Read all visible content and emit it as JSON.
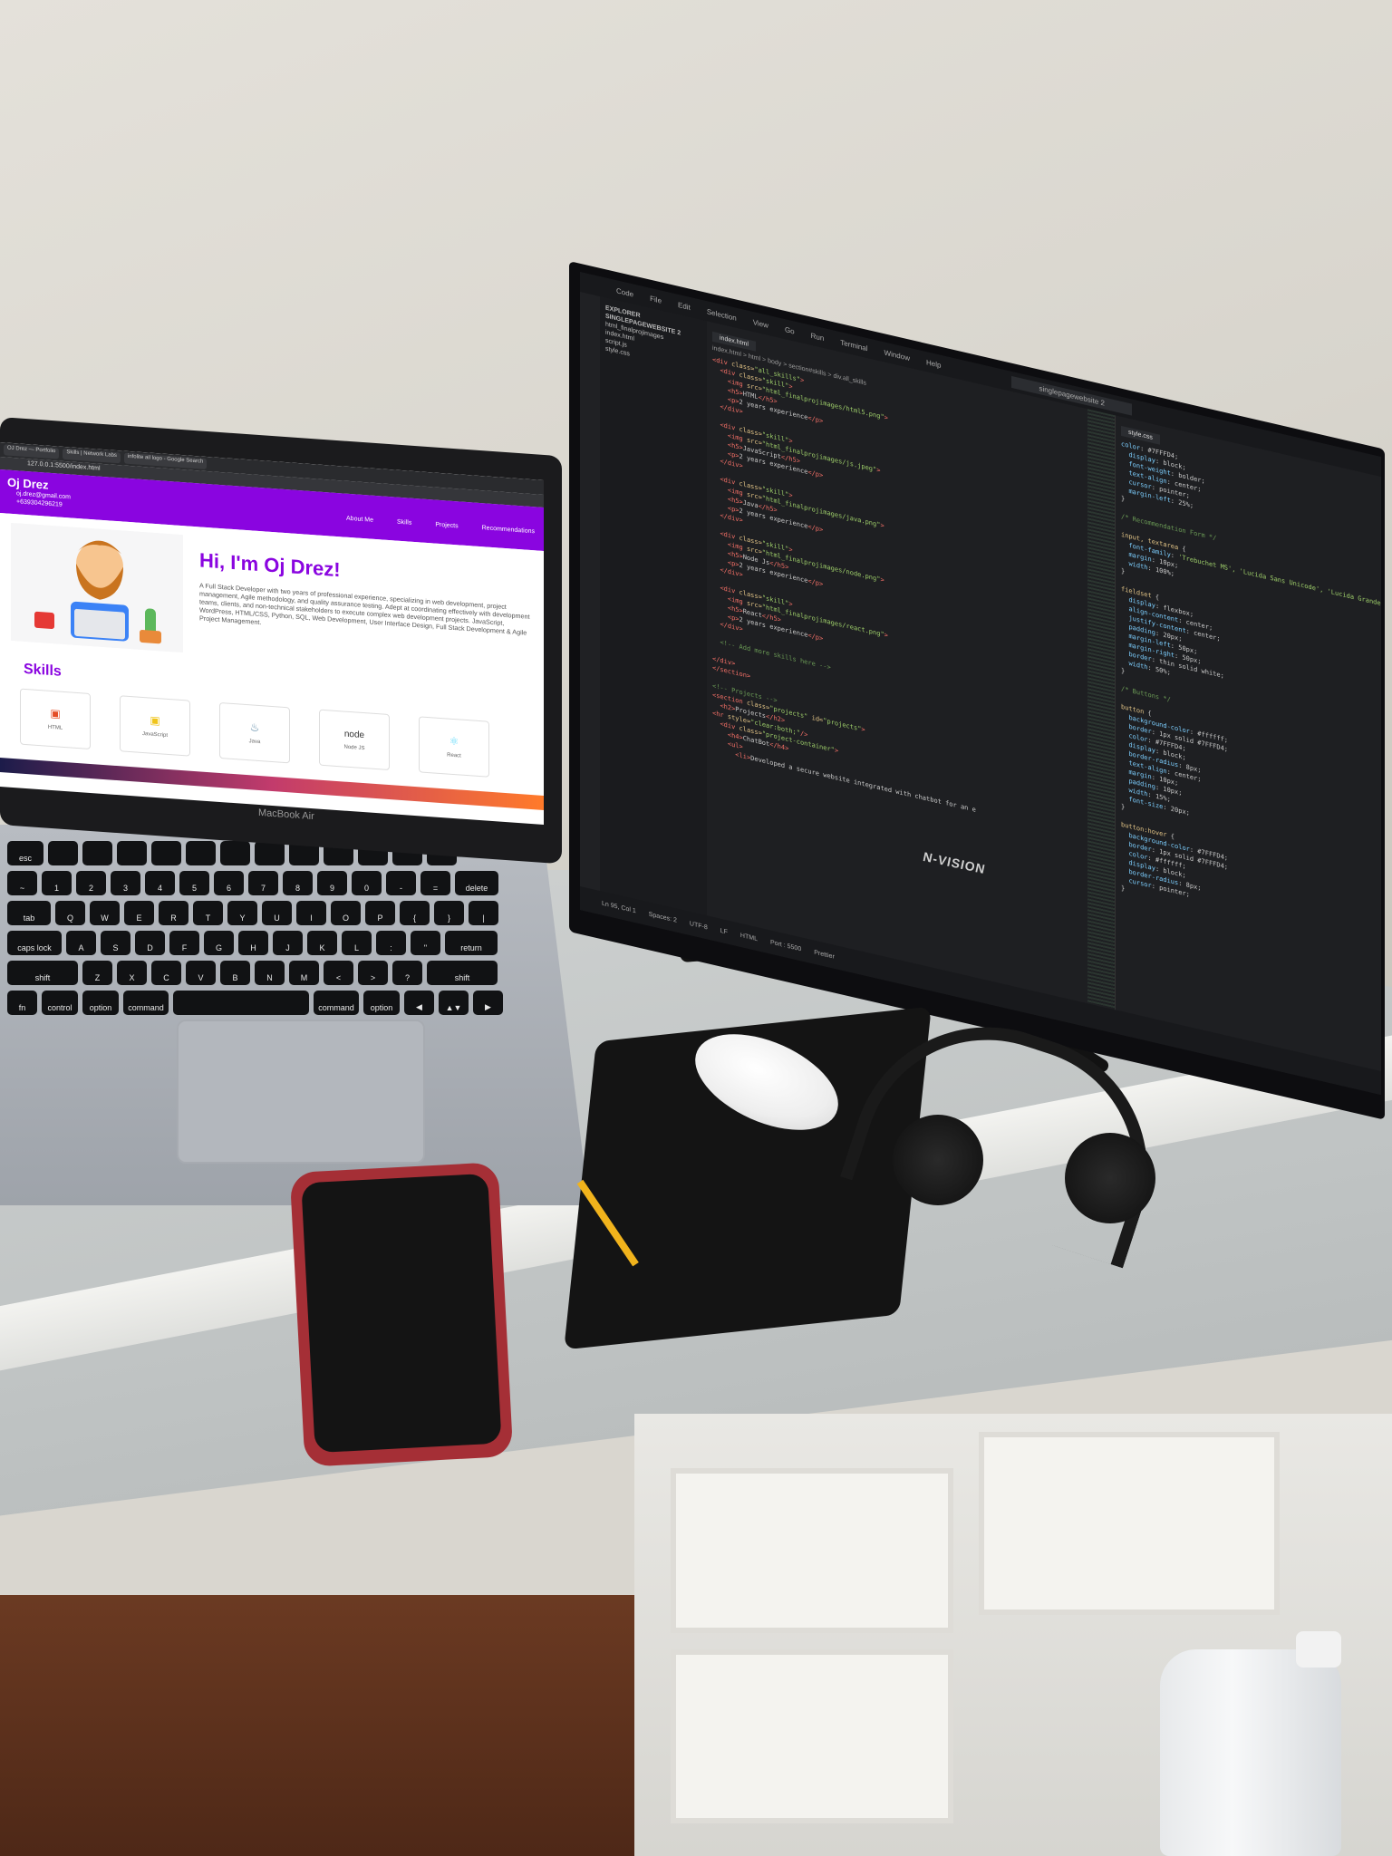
{
  "laptop": {
    "brand": "MacBook Air",
    "browser": {
      "tabs": [
        "OJ Drez — Portfolio",
        "Skills | Network Labs",
        "infolite ail logo - Google Search"
      ],
      "url": "127.0.0.1:5500/index.html"
    },
    "site": {
      "name": "Oj Drez",
      "email": "oj.drez@gmail.com",
      "phone": "+639304296219",
      "nav": [
        "About Me",
        "Skills",
        "Projects",
        "Recommendations"
      ],
      "hero_title": "Hi, I'm Oj Drez!",
      "hero_bio": "A Full Stack Developer with two years of professional experience, specializing in web development, project management, Agile methodology, and quality assurance testing. Adept at coordinating effectively with development teams, clients, and non-technical stakeholders to execute complex web development projects. JavaScript, WordPress, HTML/CSS, Python, SQL, Web Development, User Interface Design, Full Stack Development & Agile Project Management.",
      "skills_title": "Skills",
      "skills": [
        "HTML",
        "JavaScript",
        "Java",
        "Node JS",
        "React"
      ]
    },
    "keyboard": {
      "row1": [
        "esc",
        "",
        "",
        "",
        "",
        "",
        "",
        "",
        "",
        "",
        "",
        "",
        "",
        ""
      ],
      "row2": [
        "~",
        "1",
        "2",
        "3",
        "4",
        "5",
        "6",
        "7",
        "8",
        "9",
        "0",
        "-",
        "=",
        "delete"
      ],
      "row3": [
        "tab",
        "Q",
        "W",
        "E",
        "R",
        "T",
        "Y",
        "U",
        "I",
        "O",
        "P",
        "{",
        "}",
        "|"
      ],
      "row4": [
        "caps lock",
        "A",
        "S",
        "D",
        "F",
        "G",
        "H",
        "J",
        "K",
        "L",
        ":",
        "\"",
        "return"
      ],
      "row5": [
        "shift",
        "Z",
        "X",
        "C",
        "V",
        "B",
        "N",
        "M",
        "<",
        ">",
        "?",
        "shift"
      ],
      "row6": [
        "fn",
        "control",
        "option",
        "command",
        "",
        "command",
        "option",
        "◀",
        "▲▼",
        "▶"
      ]
    }
  },
  "monitor": {
    "brand": "N-VISION",
    "vscode": {
      "menu": [
        "Code",
        "File",
        "Edit",
        "Selection",
        "View",
        "Go",
        "Run",
        "Terminal",
        "Window",
        "Help"
      ],
      "explorer_title": "EXPLORER",
      "explorer_items": [
        "SINGLEPAGEWEBSITE 2",
        "html_finalprojimages",
        "index.html",
        "script.js",
        "style.css"
      ],
      "tab_left": "index.html",
      "tab_right": "style.css",
      "search": "singlepagewebsite 2",
      "breadcrumb": "index.html > html > body > section#skills > div.all_skills",
      "status": [
        "Ln 95, Col 1",
        "Spaces: 2",
        "UTF-8",
        "LF",
        "HTML",
        "Port : 5500",
        "Prettier"
      ]
    }
  }
}
